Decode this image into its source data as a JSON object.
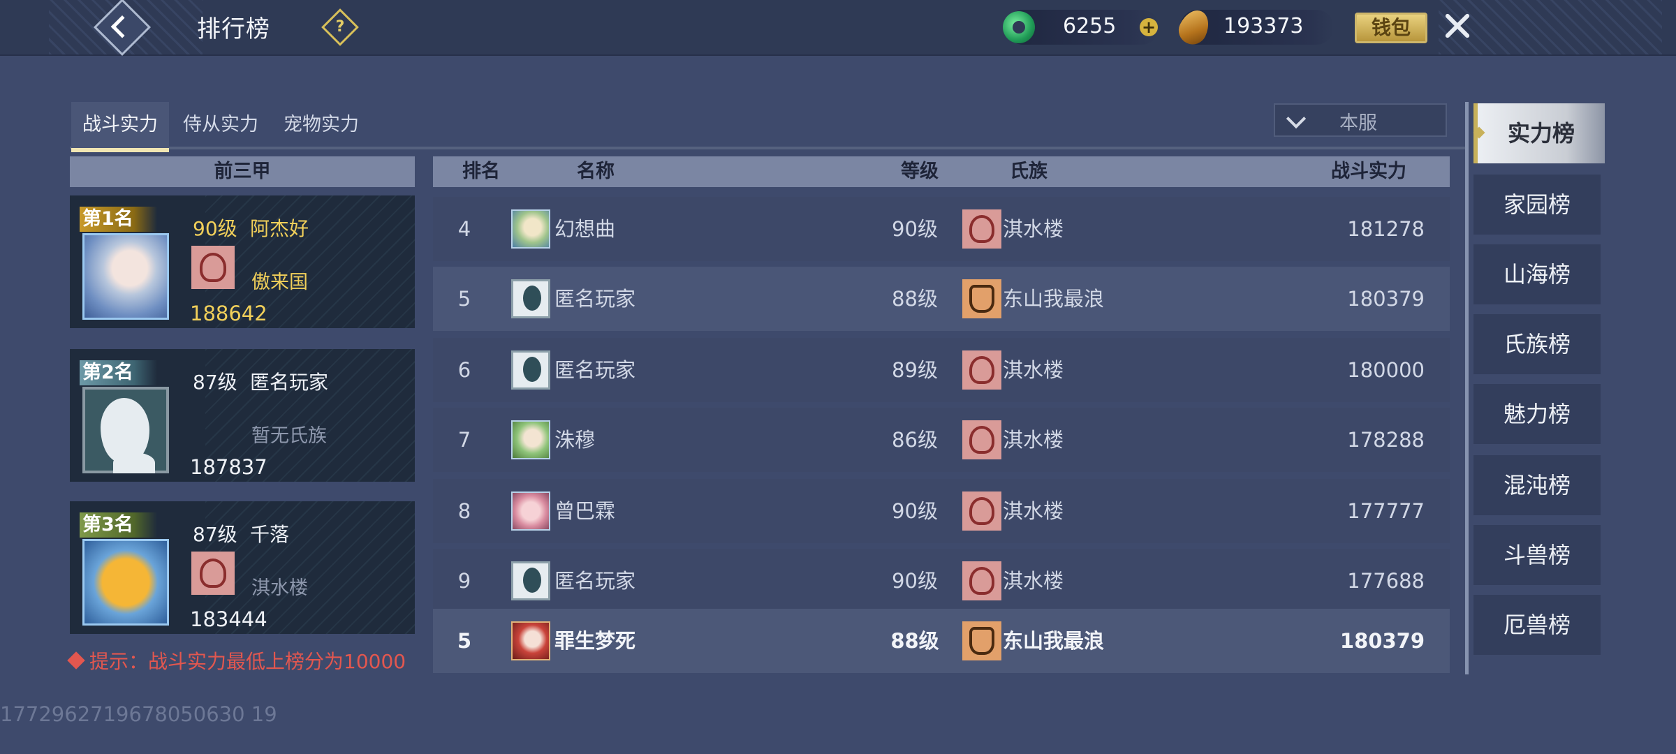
{
  "header": {
    "title": "排行榜",
    "help_label": "?",
    "jade_amount": "6255",
    "coin_amount": "193373",
    "wallet_label": "钱包"
  },
  "tabs": [
    {
      "label": "战斗实力",
      "active": true
    },
    {
      "label": "侍从实力",
      "active": false
    },
    {
      "label": "宠物实力",
      "active": false
    }
  ],
  "server_filter": {
    "selected": "本服"
  },
  "top3": {
    "heading": "前三甲",
    "entries": [
      {
        "rank_label": "第1名",
        "level": "90级",
        "name": "阿杰好",
        "clan": "傲来国",
        "power": "188642"
      },
      {
        "rank_label": "第2名",
        "level": "87级",
        "name": "匿名玩家",
        "clan": "暂无氏族",
        "power": "187837"
      },
      {
        "rank_label": "第3名",
        "level": "87级",
        "name": "千落",
        "clan": "淇水楼",
        "power": "183444"
      }
    ]
  },
  "tip": "提示：战斗实力最低上榜分为10000",
  "table": {
    "headers": {
      "rank": "排名",
      "name": "名称",
      "level": "等级",
      "clan": "氏族",
      "power": "战斗实力"
    },
    "rows": [
      {
        "rank": "4",
        "name": "幻想曲",
        "level": "90级",
        "clan": "淇水楼",
        "power": "181278",
        "avatar": "blond",
        "clan_icon": "red"
      },
      {
        "rank": "5",
        "name": "匿名玩家",
        "level": "88级",
        "clan": "东山我最浪",
        "power": "180379",
        "avatar": "silhouette",
        "clan_icon": "orange"
      },
      {
        "rank": "6",
        "name": "匿名玩家",
        "level": "89级",
        "clan": "淇水楼",
        "power": "180000",
        "avatar": "silhouette",
        "clan_icon": "red"
      },
      {
        "rank": "7",
        "name": "洙穆",
        "level": "86级",
        "clan": "淇水楼",
        "power": "178288",
        "avatar": "green",
        "clan_icon": "red"
      },
      {
        "rank": "8",
        "name": "曾巴霖",
        "level": "90级",
        "clan": "淇水楼",
        "power": "177777",
        "avatar": "pink",
        "clan_icon": "red"
      },
      {
        "rank": "9",
        "name": "匿名玩家",
        "level": "90级",
        "clan": "淇水楼",
        "power": "177688",
        "avatar": "silhouette",
        "clan_icon": "red"
      }
    ],
    "self_row": {
      "rank": "5",
      "name": "罪生梦死",
      "level": "88级",
      "clan": "东山我最浪",
      "power": "180379",
      "avatar": "red",
      "clan_icon": "orange"
    }
  },
  "side_menu": [
    {
      "label": "实力榜",
      "active": true
    },
    {
      "label": "家园榜",
      "active": false
    },
    {
      "label": "山海榜",
      "active": false
    },
    {
      "label": "氏族榜",
      "active": false
    },
    {
      "label": "魅力榜",
      "active": false
    },
    {
      "label": "混沌榜",
      "active": false
    },
    {
      "label": "斗兽榜",
      "active": false
    },
    {
      "label": "厄兽榜",
      "active": false
    }
  ],
  "watermark": "1772962719678050630 19"
}
